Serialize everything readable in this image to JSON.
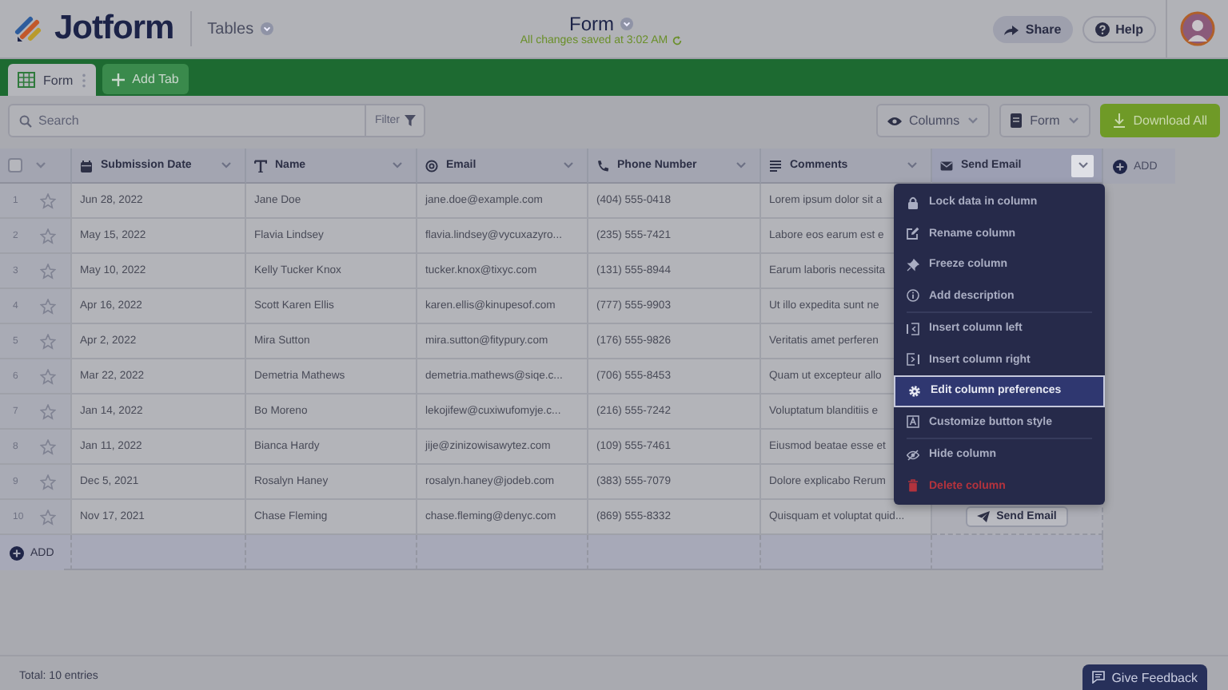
{
  "header": {
    "logo": "Jotform",
    "app": "Tables",
    "title": "Form",
    "save_status": "All changes saved at 3:02 AM",
    "share": "Share",
    "help": "Help"
  },
  "tabs": [
    {
      "label": "Form",
      "selected": true
    },
    {
      "label": "Add Tab",
      "selected": false
    }
  ],
  "toolbar": {
    "search_placeholder": "Search",
    "filter": "Filter",
    "columns": "Columns",
    "form": "Form",
    "download": "Download All"
  },
  "table": {
    "select_all": {
      "checked": false
    },
    "columns": [
      {
        "label": "Submission Date",
        "kind": "date",
        "selected": false
      },
      {
        "label": "Name",
        "kind": "text",
        "selected": false
      },
      {
        "label": "Email",
        "kind": "email",
        "selected": false
      },
      {
        "label": "Phone Number",
        "kind": "phone",
        "selected": false
      },
      {
        "label": "Comments",
        "kind": "longtext",
        "selected": false
      },
      {
        "label": "Send Email",
        "kind": "mail",
        "selected": true
      }
    ],
    "add_column": "ADD",
    "rows": [
      {
        "index": "1",
        "starred": false,
        "cells": [
          "Jun 28, 2022",
          "Jane Doe",
          "jane.doe@example.com",
          "(404) 555-0418",
          "Lorem ipsum dolor sit a"
        ]
      },
      {
        "index": "2",
        "starred": false,
        "cells": [
          "May 15, 2022",
          "Flavia Lindsey",
          "flavia.lindsey@vycuxazyro...",
          "(235) 555-7421",
          "Labore eos earum est e"
        ]
      },
      {
        "index": "3",
        "starred": false,
        "cells": [
          "May 10, 2022",
          "Kelly Tucker Knox",
          "tucker.knox@tixyc.com",
          "(131) 555-8944",
          "Earum laboris necessita"
        ]
      },
      {
        "index": "4",
        "starred": false,
        "cells": [
          "Apr 16, 2022",
          "Scott Karen Ellis",
          "karen.ellis@kinupesof.com",
          "(777) 555-9903",
          "Ut illo expedita sunt ne"
        ]
      },
      {
        "index": "5",
        "starred": false,
        "cells": [
          "Apr 2, 2022",
          "Mira Sutton",
          "mira.sutton@fitypury.com",
          "(176) 555-9826",
          "Veritatis amet perferen"
        ]
      },
      {
        "index": "6",
        "starred": false,
        "cells": [
          "Mar 22, 2022",
          "Demetria Mathews",
          "demetria.mathews@siqe.c...",
          "(706) 555-8453",
          "Quam ut excepteur allo"
        ]
      },
      {
        "index": "7",
        "starred": false,
        "cells": [
          "Jan 14, 2022",
          "Bo Moreno",
          "lekojifew@cuxiwufomyje.c...",
          "(216) 555-7242",
          "Voluptatum blanditiis e"
        ]
      },
      {
        "index": "8",
        "starred": false,
        "cells": [
          "Jan 11, 2022",
          "Bianca Hardy",
          "jije@zinizowisawytez.com",
          "(109) 555-7461",
          "Eiusmod beatae esse et"
        ]
      },
      {
        "index": "9",
        "starred": false,
        "cells": [
          "Dec 5, 2021",
          "Rosalyn Haney",
          "rosalyn.haney@jodeb.com",
          "(383) 555-7079",
          "Dolore explicabo Rerum"
        ]
      },
      {
        "index": "10",
        "starred": false,
        "cells": [
          "Nov 17, 2021",
          "Chase Fleming",
          "chase.fleming@denyc.com",
          "(869) 555-8332",
          "Quisquam et voluptat quid..."
        ],
        "send_email": "Send Email"
      }
    ],
    "add_row": "ADD"
  },
  "column_menu": {
    "groups": [
      {
        "items": [
          {
            "label": "Lock data in column",
            "selected": false,
            "danger": false
          },
          {
            "label": "Rename column",
            "selected": false,
            "danger": false
          },
          {
            "label": "Freeze column",
            "selected": false,
            "danger": false
          },
          {
            "label": "Add description",
            "selected": false,
            "danger": false
          }
        ]
      },
      {
        "items": [
          {
            "label": "Insert column left",
            "selected": false,
            "danger": false
          },
          {
            "label": "Insert column right",
            "selected": false,
            "danger": false
          },
          {
            "label": "Edit column preferences",
            "selected": true,
            "danger": false
          },
          {
            "label": "Customize button style",
            "selected": false,
            "danger": false
          }
        ]
      },
      {
        "items": [
          {
            "label": "Hide column",
            "selected": false,
            "danger": false
          },
          {
            "label": "Delete column",
            "selected": false,
            "danger": true
          }
        ]
      }
    ]
  },
  "footer": {
    "total": "Total: 10 entries",
    "feedback": "Give Feedback"
  }
}
